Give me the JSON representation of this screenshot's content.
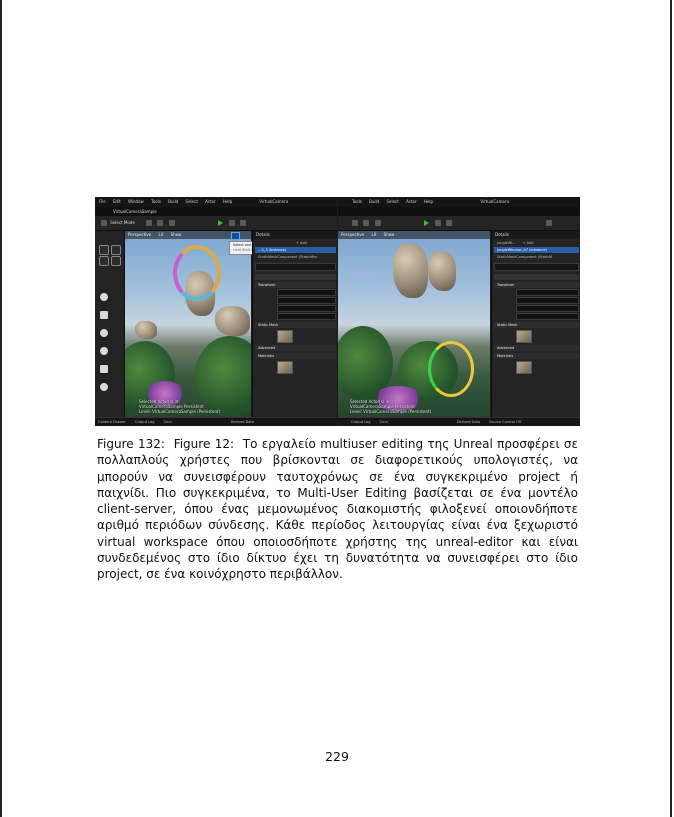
{
  "figure": {
    "left_window": {
      "menu": [
        "File",
        "Edit",
        "Window",
        "Tools",
        "Build",
        "Select",
        "Actor",
        "Help"
      ],
      "title": "VirtualCamera",
      "tab": "VirtualCameraSample",
      "select_mode": "Select Mode",
      "viewport_buttons": [
        "Perspective",
        "Lit",
        "Show"
      ],
      "tooltip_title": "Select and translate objects (W)",
      "tooltip_sub": "Hold Shift to snap...",
      "details_title": "Details",
      "add_label": "+ Add",
      "selected_item": "...3_3 (Instance)",
      "component_item": "StaticMeshComponent (StaticMes",
      "section_transform": "Transform",
      "section_static_mesh": "Static Mesh",
      "section_advanced": "Advanced",
      "section_materials": "Materials",
      "overlay_text": [
        "Selected Actor(s) in:",
        "VirtualCameraSample Persistent",
        "Level: VirtualCameraSample (Persistent)"
      ],
      "bottom_bar": [
        "Content Drawer",
        "Output Log",
        "Cmd",
        "Derived Data"
      ]
    },
    "right_window": {
      "menu": [
        "Tools",
        "Build",
        "Select",
        "Actor",
        "Help"
      ],
      "title": "VirtualCamera",
      "viewport_buttons": [
        "Perspective",
        "Lit",
        "Show"
      ],
      "viewport_label": "Computer A",
      "details_title": "Details",
      "actor_name": "JungleWi...",
      "add_label": "+ Add",
      "selected_item": "JungleWindow_A7 (Instance)",
      "component_item": "StaticMeshComponent (StaticM",
      "section_transform": "Transform",
      "section_static_mesh": "Static Mesh",
      "section_advanced": "Advanced",
      "section_materials": "Materials",
      "overlay_text": [
        "Selected Actor(s) in:",
        "VirtualCameraSample Persistent",
        "Level: VirtualCameraSample (Persistent)"
      ],
      "bottom_bar": [
        "Output Log",
        "Cmd",
        "Derived Data",
        "Source Control Off"
      ]
    }
  },
  "caption": {
    "label": "Figure 132:  Figure 12:  ",
    "text": "Το εργαλείο multiuser editing της Unreal προσφέρει σε πολλαπλούς χρήστες που βρίσκονται σε διαφορετικούς υπολογιστές, να μπορούν να συνεισφέρουν ταυτοχρόνως σε ένα συγκεκριμένο project ή παιχνίδι.  Πιο συγκεκριμένα, το Multi-User Editing βασίζεται σε ένα μοντέλο client-server, όπου ένας μεμονωμένος διακομιστής φιλοξενεί οποιονδήποτε αριθμό περιόδων σύνδεσης.  Κάθε περίοδος λειτουργίας είναι ένα ξεχωριστό virtual workspace όπου οποιοσδήποτε χρήστης της unreal-editor και είναι συνδεδεμένος στο ίδιο δίκτυο έχει τη δυνατότητα να συνεισφέρει στο ίδιο project, σε ένα κοινόχρηστο περιβάλλον."
  },
  "page_number": "229"
}
